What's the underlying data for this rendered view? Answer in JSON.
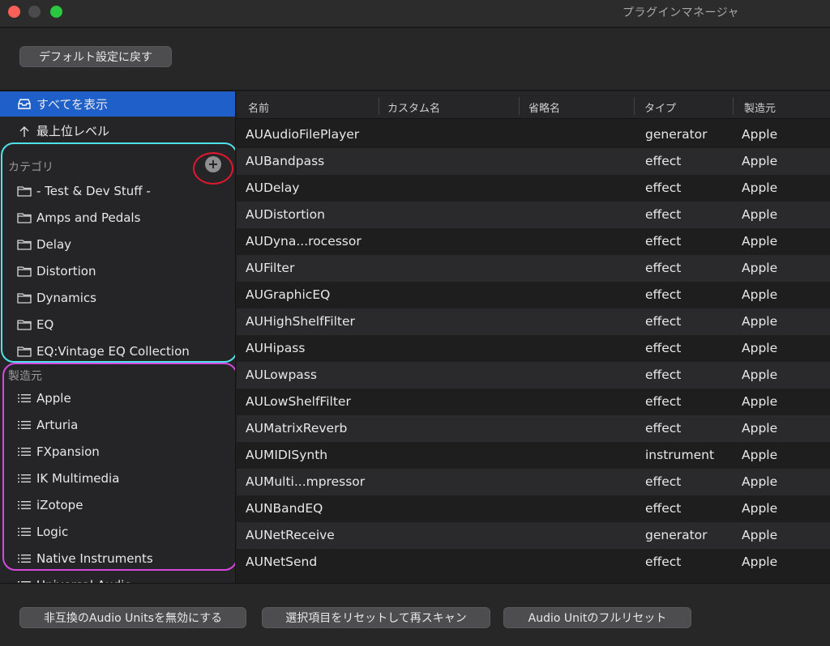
{
  "window": {
    "title": "プラグインマネージャ"
  },
  "toolbar": {
    "default_label": "デフォルト設定に戻す"
  },
  "sidebar": {
    "show_all": "すべてを表示",
    "top_level": "最上位レベル",
    "category_header": "カテゴリ",
    "categories": [
      "- Test & Dev Stuff -",
      "Amps and Pedals",
      "Delay",
      "Distortion",
      "Dynamics",
      "EQ",
      "EQ:Vintage EQ Collection"
    ],
    "manufacturer_header": "製造元",
    "manufacturers": [
      "Apple",
      "Arturia",
      "FXpansion",
      "IK Multimedia",
      "iZotope",
      "Logic",
      "Native Instruments",
      "Universal Audio"
    ],
    "add_icon": "plus-circle-icon"
  },
  "table": {
    "headers": [
      "名前",
      "カスタム名",
      "省略名",
      "タイプ",
      "製造元"
    ],
    "rows": [
      {
        "name": "AUAudioFilePlayer",
        "type": "generator",
        "manufacturer": "Apple"
      },
      {
        "name": "AUBandpass",
        "type": "effect",
        "manufacturer": "Apple"
      },
      {
        "name": "AUDelay",
        "type": "effect",
        "manufacturer": "Apple"
      },
      {
        "name": "AUDistortion",
        "type": "effect",
        "manufacturer": "Apple"
      },
      {
        "name": "AUDyna...rocessor",
        "type": "effect",
        "manufacturer": "Apple"
      },
      {
        "name": "AUFilter",
        "type": "effect",
        "manufacturer": "Apple"
      },
      {
        "name": "AUGraphicEQ",
        "type": "effect",
        "manufacturer": "Apple"
      },
      {
        "name": "AUHighShelfFilter",
        "type": "effect",
        "manufacturer": "Apple"
      },
      {
        "name": "AUHipass",
        "type": "effect",
        "manufacturer": "Apple"
      },
      {
        "name": "AULowpass",
        "type": "effect",
        "manufacturer": "Apple"
      },
      {
        "name": "AULowShelfFilter",
        "type": "effect",
        "manufacturer": "Apple"
      },
      {
        "name": "AUMatrixReverb",
        "type": "effect",
        "manufacturer": "Apple"
      },
      {
        "name": "AUMIDISynth",
        "type": "instrument",
        "manufacturer": "Apple"
      },
      {
        "name": "AUMulti...mpressor",
        "type": "effect",
        "manufacturer": "Apple"
      },
      {
        "name": "AUNBandEQ",
        "type": "effect",
        "manufacturer": "Apple"
      },
      {
        "name": "AUNetReceive",
        "type": "generator",
        "manufacturer": "Apple"
      },
      {
        "name": "AUNetSend",
        "type": "effect",
        "manufacturer": "Apple"
      }
    ]
  },
  "bottom": {
    "disable_incompatible": "非互換のAudio Unitsを無効にする",
    "reset_rescan": "選択項目をリセットして再スキャン",
    "full_reset": "Audio Unitのフルリセット"
  },
  "colors": {
    "selection": "#1f5fc9",
    "annotation_cyan": "#4fe3e8",
    "annotation_magenta": "#d648e0",
    "annotation_red": "#e3172f"
  }
}
